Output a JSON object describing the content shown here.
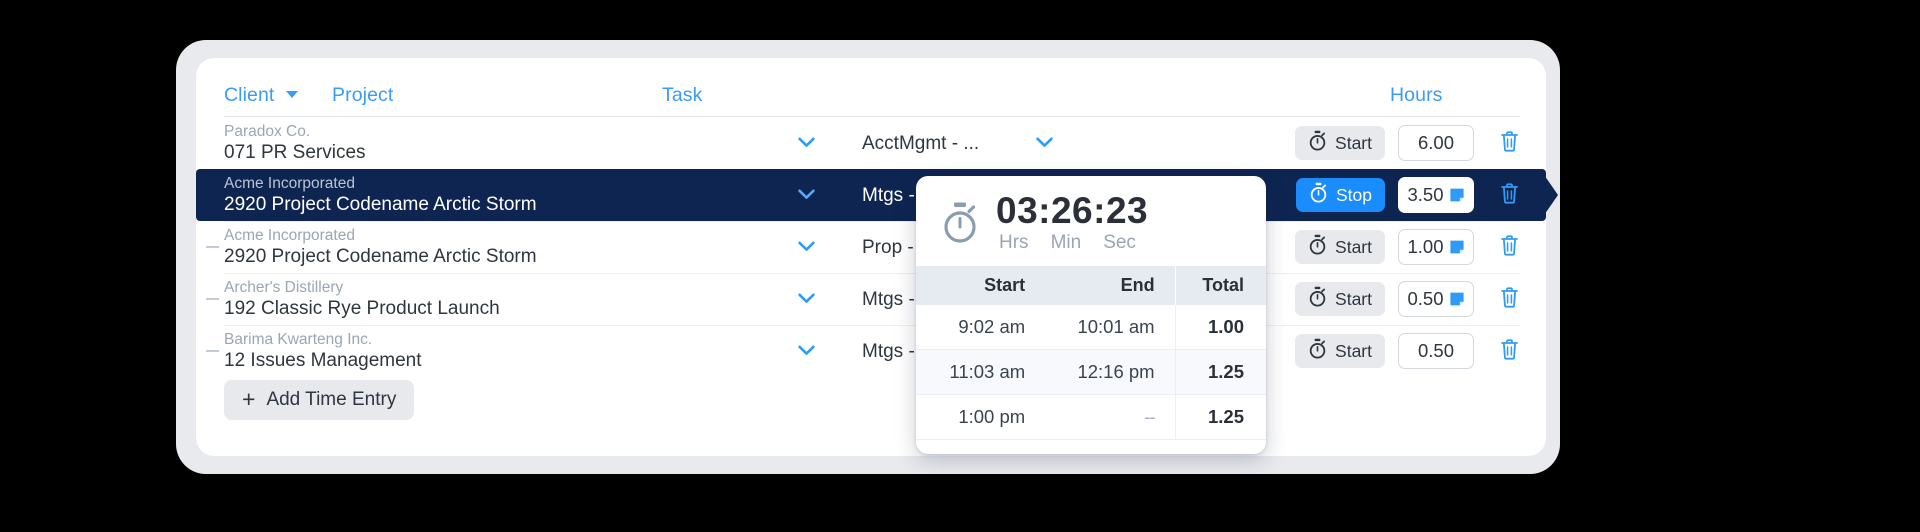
{
  "table": {
    "columns": {
      "client": "Client",
      "project": "Project",
      "task": "Task",
      "hours": "Hours"
    },
    "rows": [
      {
        "client": "Paradox Co.",
        "project": "071 PR Services",
        "task": "AcctMgmt - ...",
        "timer_label": "Start",
        "hours": "6.00",
        "has_note": false,
        "running": false
      },
      {
        "client": "Acme Incorporated",
        "project": "2920 Project Codename Arctic Storm",
        "task": "Mtgs - Meetings",
        "timer_label": "Stop",
        "hours": "3.50",
        "has_note": true,
        "running": true
      },
      {
        "client": "Acme Incorporated",
        "project": "2920 Project Codename Arctic Storm",
        "task": "Prop - Proposals",
        "timer_label": "Start",
        "hours": "1.00",
        "has_note": true,
        "running": false
      },
      {
        "client": "Archer's Distillery",
        "project": "192 Classic Rye Product Launch",
        "task": "Mtgs - Meetings",
        "timer_label": "Start",
        "hours": "0.50",
        "has_note": true,
        "running": false
      },
      {
        "client": "Barima Kwarteng Inc.",
        "project": "12 Issues Management",
        "task": "Mtgs - Meetings",
        "timer_label": "Start",
        "hours": "0.50",
        "has_note": false,
        "running": false
      }
    ],
    "add_entry_label": "Add Time Entry",
    "add_entry_plus": "+"
  },
  "timer_popover": {
    "elapsed": "03:26:23",
    "units": {
      "hrs": "Hrs",
      "min": "Min",
      "sec": "Sec"
    },
    "columns": {
      "start": "Start",
      "end": "End",
      "total": "Total"
    },
    "entries": [
      {
        "start": "9:02 am",
        "end": "10:01 am",
        "total": "1.00"
      },
      {
        "start": "11:03 am",
        "end": "12:16 pm",
        "total": "1.25"
      },
      {
        "start": "1:00 pm",
        "end": "--",
        "total": "1.25"
      }
    ]
  },
  "colors": {
    "accent_blue": "#3b9bf5",
    "running_blue": "#1a8cfb",
    "selected_navy": "#0f2551",
    "muted_text": "#9aa6b4",
    "body_text": "#2f3640"
  }
}
